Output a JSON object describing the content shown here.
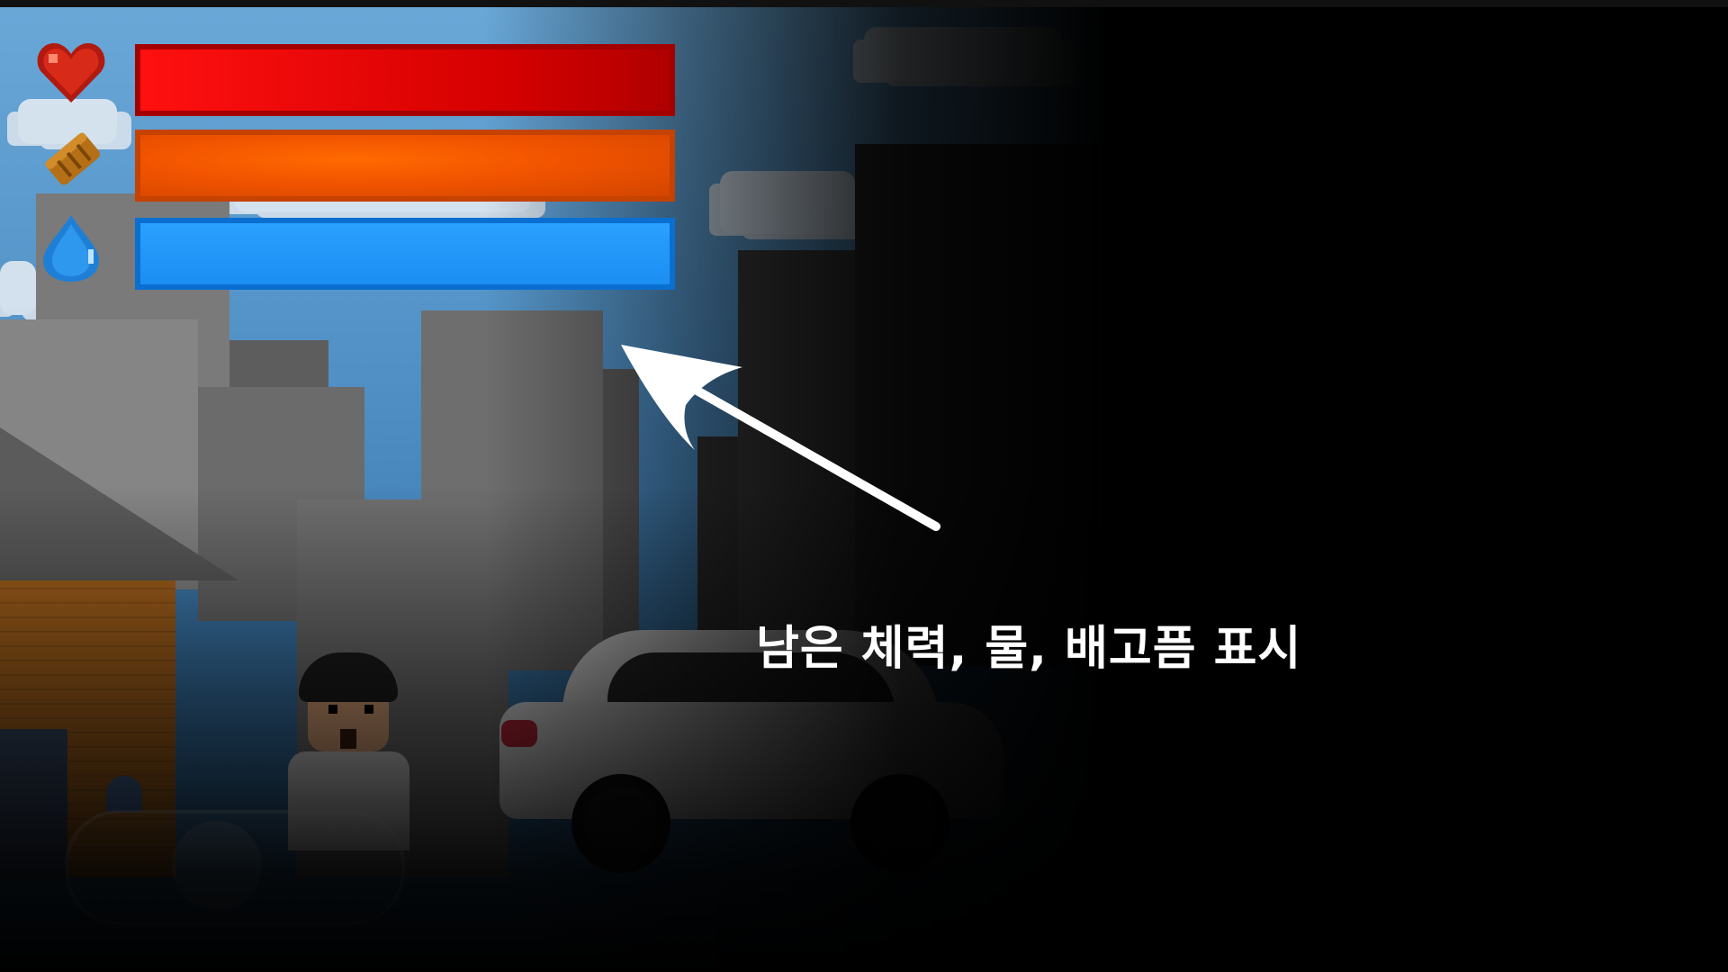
{
  "hud": {
    "health": {
      "icon": "heart-icon",
      "level": 1.0,
      "color": "#e00000"
    },
    "hunger": {
      "icon": "bread-icon",
      "level": 1.0,
      "color": "#f25400"
    },
    "water": {
      "icon": "water-drop-icon",
      "level": 1.0,
      "color": "#1c8ef2"
    }
  },
  "annotation": {
    "caption": "남은 체력, 물, 배고픔 표시",
    "arrow_icon": "arrow-icon",
    "color": "#ffffff"
  },
  "scene": {
    "character": "player-character",
    "vehicle": "white-car",
    "controls": "virtual-joystick"
  }
}
